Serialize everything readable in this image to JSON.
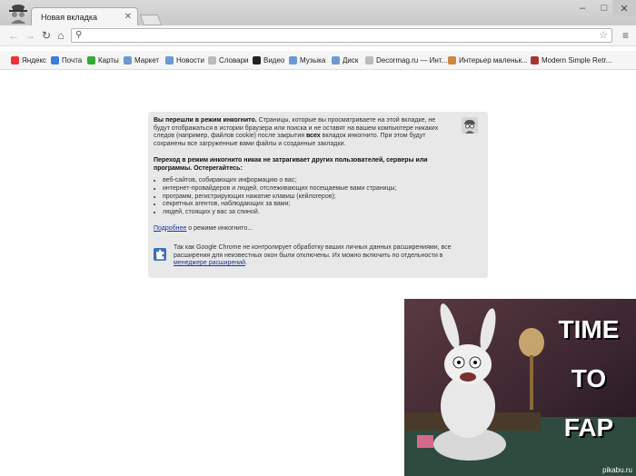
{
  "tab": {
    "title": "Новая вкладка"
  },
  "window": {
    "minimize": "–",
    "maximize": "□",
    "close": "✕"
  },
  "toolbar": {
    "back": "←",
    "forward": "→",
    "reload": "↻",
    "home": "⌂",
    "url_value": "",
    "menu": "≡"
  },
  "bookmarks": [
    "Яндекс",
    "Почта",
    "Карты",
    "Маркет",
    "Новости",
    "Словари",
    "Видео",
    "Музыка",
    "Диск",
    "Decormag.ru — Инт...",
    "Интерьер маленьк...",
    "Modern Simple Retr..."
  ],
  "incognito": {
    "p1_bold": "Вы перешли в режим инкогнито.",
    "p1_text": " Страницы, которые вы просматриваете на этой вкладке, не будут отображаться в истории браузера или поиска и не оставят на вашем компьютере никаких следов (например, файлов cookie) после закрытия ",
    "p1_bold2": "всех",
    "p1_text2": " вкладок инкогнито. При этом будут сохранены все загруженные вами файлы и созданные закладки.",
    "p2_bold": "Переход в режим инкогнито никак не затрагивает других пользователей, серверы или программы. Остерегайтесь:",
    "list": [
      "веб-сайтов, собирающих информацию о вас;",
      "интернет-провайдеров и людей, отслеживающих посещаемые вами страницы;",
      "программ, регистрирующих нажатие клавиш (кейлогеров);",
      "секретных агентов, наблюдающих за вами;",
      "людей, стоящих у вас за спиной."
    ],
    "more_link": "Подробнее",
    "more_text": " о режиме инкогнито...",
    "ext_text": "Так как Google Chrome не контролирует обработку ваших личных данных расширениями, все расширения для неизвестных окон были отключены. Их можно включить по отдельности в ",
    "ext_link": "менеджере расширений",
    "ext_end": "."
  },
  "meme": {
    "line1": "TIME",
    "line2": "TO",
    "line3": "FAP",
    "watermark": "pikabu.ru"
  }
}
